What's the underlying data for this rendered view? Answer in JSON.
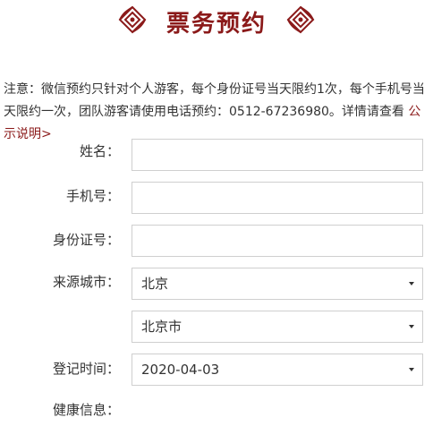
{
  "header": {
    "title": "票务预约"
  },
  "notice": {
    "text": "注意：微信预约只针对个人游客，每个身份证号当天限约1次，每个手机号当天限约一次，团队游客请使用电话预约：0512-67236980。详情请查看 ",
    "link": "公示说明>"
  },
  "form": {
    "name_label": "姓名：",
    "phone_label": "手机号：",
    "id_label": "身份证号：",
    "city_label": "来源城市：",
    "province_value": "北京",
    "city_value": "北京市",
    "date_label": "登记时间：",
    "date_value": "2020-04-03",
    "health_label": "健康信息："
  },
  "colors": {
    "accent": "#8b1a1a",
    "border": "#cfcfcf"
  }
}
